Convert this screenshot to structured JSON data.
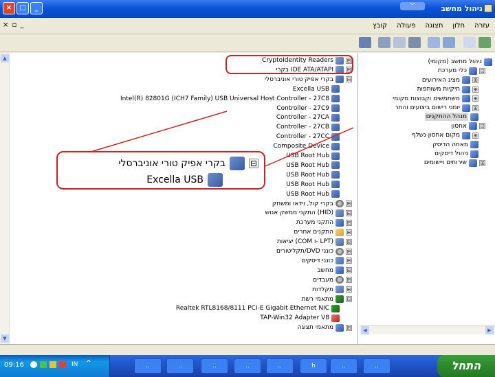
{
  "window": {
    "title": "ניהול מחשב",
    "min_btn": "_",
    "max_btn": "□",
    "close_btn": "×"
  },
  "menubar": {
    "items": [
      "קובץ",
      "פעולה",
      "תצוגה",
      "חלון",
      "עזרה"
    ],
    "mdi_controls": "× ▫ _"
  },
  "tree_right": [
    {
      "label": "ניהול מחשב (מקומי)",
      "icon": "computer-icon",
      "exp": ""
    },
    {
      "label": "כלי מערכת",
      "icon": "tools-icon",
      "exp": "⊟"
    },
    {
      "label": "מציג האירועים",
      "icon": "event-icon",
      "exp": "⊞"
    },
    {
      "label": "תיקיות משותפות",
      "icon": "folder-icon",
      "exp": "⊞"
    },
    {
      "label": "משתמשים וקבוצות מקומי",
      "icon": "users-icon",
      "exp": "⊞"
    },
    {
      "label": "יומני רישום ביצועים והתר",
      "icon": "perf-icon",
      "exp": "⊞"
    },
    {
      "label": "מנהל ההתקנים",
      "icon": "device-manager-icon",
      "exp": ""
    },
    {
      "label": "אחסון",
      "icon": "storage-icon",
      "exp": "⊟"
    },
    {
      "label": "מקום אחסון נשלף",
      "icon": "removable-icon",
      "exp": "⊞"
    },
    {
      "label": "מאחה הדיסק",
      "icon": "defrag-icon",
      "exp": ""
    },
    {
      "label": "ניהול דיסקים",
      "icon": "disk-icon",
      "exp": ""
    },
    {
      "label": "שירותים ויישומים",
      "icon": "services-icon",
      "exp": "⊞"
    }
  ],
  "tree_left": [
    {
      "label": "CryptoIdentity Readers",
      "exp": "⊞",
      "icon": "dev"
    },
    {
      "label": "IDE ATA/ATAPI בקרי",
      "exp": "⊞",
      "icon": "dev"
    },
    {
      "label": "בקרי אפיק טורי אוניברסלי",
      "exp": "⊟",
      "icon": "usb"
    },
    {
      "label": "Excella USB",
      "exp": "",
      "icon": "usb"
    },
    {
      "label": "Intel(R) 82801G (ICH7 Family) USB Universal Host Controller - 27C8",
      "exp": "",
      "icon": "usb"
    },
    {
      "label": "Controller - 27C9",
      "exp": "",
      "icon": "usb"
    },
    {
      "label": "Controller - 27CA",
      "exp": "",
      "icon": "usb"
    },
    {
      "label": "Controller - 27CB",
      "exp": "",
      "icon": "usb"
    },
    {
      "label": "Controller - 27CC",
      "exp": "",
      "icon": "usb"
    },
    {
      "label": "Composite Device",
      "exp": "",
      "icon": "usb"
    },
    {
      "label": "USB Root Hub",
      "exp": "",
      "icon": "usb"
    },
    {
      "label": "USB Root Hub",
      "exp": "",
      "icon": "usb"
    },
    {
      "label": "USB Root Hub",
      "exp": "",
      "icon": "usb"
    },
    {
      "label": "USB Root Hub",
      "exp": "",
      "icon": "usb"
    },
    {
      "label": "USB Root Hub",
      "exp": "",
      "icon": "usb"
    },
    {
      "label": "בקרי קול, וידאו ומשחק",
      "exp": "⊞",
      "icon": "gear"
    },
    {
      "label": "(HID) התקני ממשק אנוש",
      "exp": "⊞",
      "icon": "dev"
    },
    {
      "label": "התקני מערכת",
      "exp": "⊞",
      "icon": "comp"
    },
    {
      "label": "התקנים אחרים",
      "exp": "⊞",
      "icon": "folder"
    },
    {
      "label": "(LPT -ו COM) יציאות",
      "exp": "⊞",
      "icon": "dev"
    },
    {
      "label": "כונני DVD/תקליטורים",
      "exp": "⊞",
      "icon": "gear"
    },
    {
      "label": "כונני דיסקים",
      "exp": "⊞",
      "icon": "dev"
    },
    {
      "label": "מחשב",
      "exp": "⊞",
      "icon": "comp"
    },
    {
      "label": "מעבדים",
      "exp": "⊞",
      "icon": "gear"
    },
    {
      "label": "מקלדות",
      "exp": "⊞",
      "icon": "dev"
    },
    {
      "label": "מתאמי רשת",
      "exp": "⊟",
      "icon": "net"
    },
    {
      "label": "Realtek RTL8168/8111 PCI-E Gigabit Ethernet NIC",
      "exp": "",
      "icon": "net"
    },
    {
      "label": "TAP-Win32 Adapter V8",
      "exp": "",
      "icon": "red"
    },
    {
      "label": "מתאמי תצוגה",
      "exp": "⊞",
      "icon": "comp"
    }
  ],
  "zoom": {
    "parent": "בקרי אפיק טורי אוניברסלי",
    "child": "Excella USB",
    "exp": "⊟"
  },
  "taskbar": {
    "start": "התחל",
    "clock": "09:16",
    "lang": "IN",
    "tasks": [
      "..",
      "..",
      "..",
      "..",
      "..",
      "h",
      "..",
      ".."
    ]
  },
  "scroll": {
    "up": "▲",
    "down": "▼",
    "left": "◀",
    "right": "▶"
  }
}
